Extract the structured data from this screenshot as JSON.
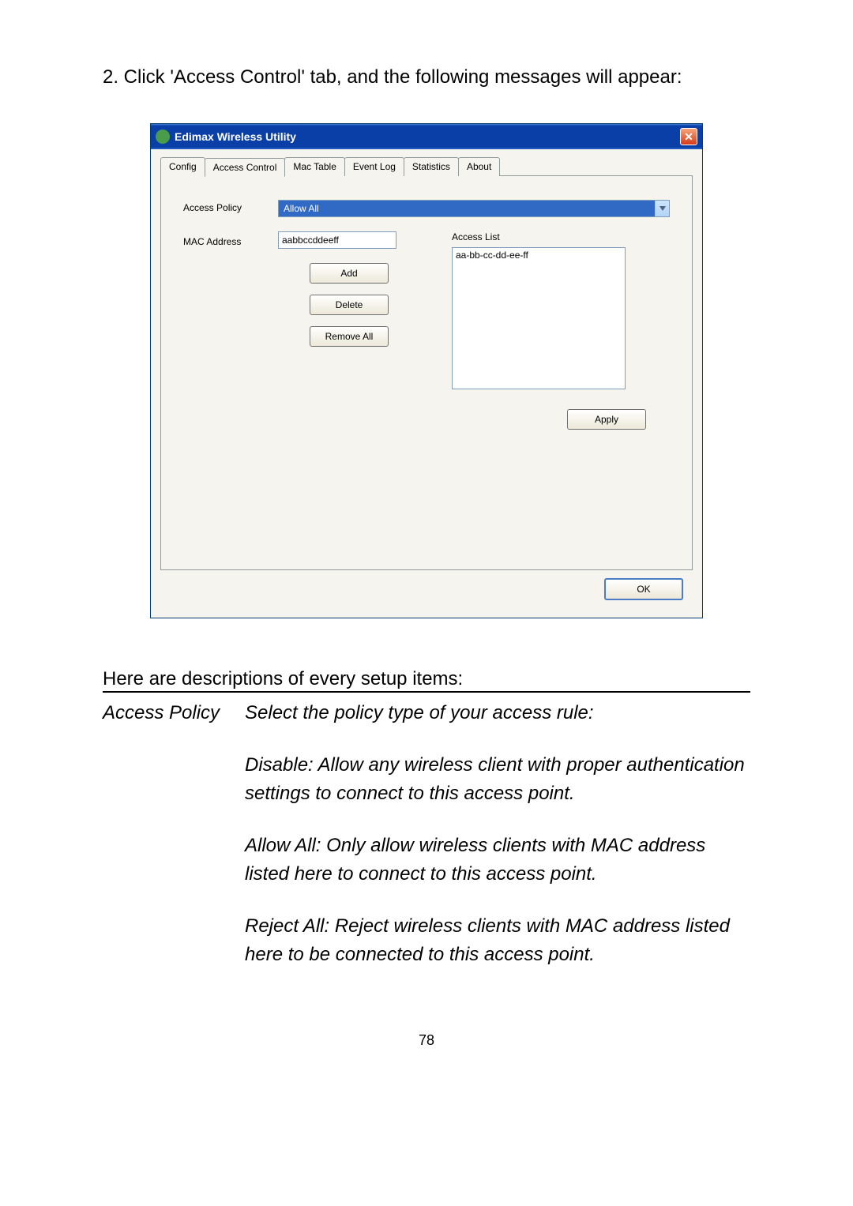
{
  "page": {
    "intro": "2. Click 'Access Control' tab, and the following messages will appear:",
    "pageNumber": "78"
  },
  "dialog": {
    "title": "Edimax Wireless Utility",
    "tabs": {
      "config": "Config",
      "accessControl": "Access Control",
      "macTable": "Mac Table",
      "eventLog": "Event Log",
      "statistics": "Statistics",
      "about": "About"
    },
    "labels": {
      "accessPolicy": "Access Policy",
      "macAddress": "MAC Address",
      "accessList": "Access List"
    },
    "values": {
      "policySelected": "Allow All",
      "macInput": "aabbccddeeff",
      "listEntry": "aa-bb-cc-dd-ee-ff"
    },
    "buttons": {
      "add": "Add",
      "delete": "Delete",
      "removeAll": "Remove All",
      "apply": "Apply",
      "ok": "OK"
    }
  },
  "descriptions": {
    "intro": "Here are descriptions of every setup items:",
    "label": "Access Policy",
    "lead": "Select the policy type of your access rule:",
    "para1": "Disable: Allow any wireless client with proper authentication settings to connect to this access point.",
    "para2": "Allow All: Only allow wireless clients with MAC address listed here to connect to this access point.",
    "para3": "Reject All: Reject wireless clients with MAC address listed here to be connected to this access point."
  }
}
